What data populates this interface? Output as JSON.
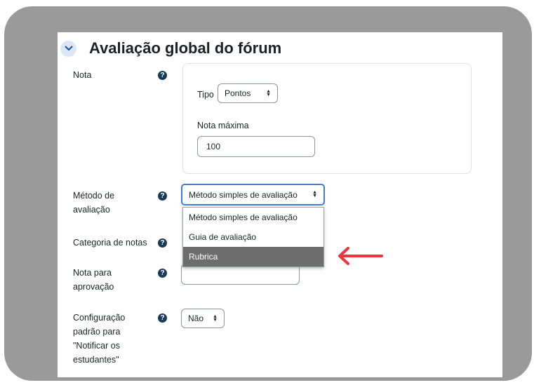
{
  "section": {
    "title": "Avaliação global do fórum"
  },
  "fields": {
    "nota": {
      "label": "Nota"
    },
    "tipo": {
      "label": "Tipo",
      "value": "Pontos"
    },
    "nota_maxima": {
      "label": "Nota máxima",
      "value": "100"
    },
    "metodo": {
      "label_line1": "Método de",
      "label_line2": "avaliação",
      "value": "Método simples de avaliação",
      "options": [
        "Método simples de avaliação",
        "Guia de avaliação",
        "Rubrica"
      ],
      "highlighted_option": "Rubrica"
    },
    "categoria": {
      "label": "Categoria de notas"
    },
    "nota_aprovacao": {
      "label_line1": "Nota para",
      "label_line2": "aprovação",
      "value": ""
    },
    "notificar": {
      "label_line1": "Configuração",
      "label_line2": "padrão para",
      "label_line3": "\"Notificar os",
      "label_line4": "estudantes\"",
      "value": "Não"
    }
  },
  "colors": {
    "frame": "#9a9a9a",
    "help_icon": "#1b3a57",
    "focus_border": "#3b7fd9",
    "selected_option": "#6d6d6d",
    "arrow": "#e8373f"
  },
  "icons": {
    "collapse": "chevron-down-icon",
    "help": "question-circle-icon",
    "annotation": "arrow-left-icon"
  }
}
